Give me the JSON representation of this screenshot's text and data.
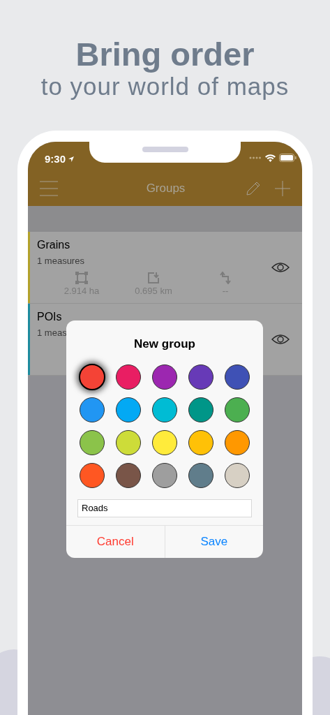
{
  "headline": {
    "title": "Bring order",
    "subtitle": "to your world of maps"
  },
  "status_bar": {
    "time": "9:30"
  },
  "nav_bar": {
    "title": "Groups"
  },
  "groups": [
    {
      "name": "Grains",
      "subtitle": "1 measures",
      "color": "#b3a22c",
      "stats": [
        {
          "kind": "area",
          "value": "2.914 ha"
        },
        {
          "kind": "length",
          "value": "0.695 km"
        },
        {
          "kind": "route",
          "value": "--"
        }
      ]
    },
    {
      "name": "POIs",
      "subtitle": "1 meas",
      "color": "#1e8c9e"
    }
  ],
  "dialog": {
    "title": "New group",
    "swatches": [
      {
        "color": "#f44336",
        "selected": true
      },
      {
        "color": "#e91e63",
        "selected": false
      },
      {
        "color": "#9c27b0",
        "selected": false
      },
      {
        "color": "#673ab7",
        "selected": false
      },
      {
        "color": "#3f51b5",
        "selected": false
      },
      {
        "color": "#2196f3",
        "selected": false
      },
      {
        "color": "#03a9f4",
        "selected": false
      },
      {
        "color": "#00bcd4",
        "selected": false
      },
      {
        "color": "#009688",
        "selected": false
      },
      {
        "color": "#4caf50",
        "selected": false
      },
      {
        "color": "#8bc34a",
        "selected": false
      },
      {
        "color": "#cddc39",
        "selected": false
      },
      {
        "color": "#ffeb3b",
        "selected": false
      },
      {
        "color": "#ffc107",
        "selected": false
      },
      {
        "color": "#ff9800",
        "selected": false
      },
      {
        "color": "#ff5722",
        "selected": false
      },
      {
        "color": "#795548",
        "selected": false
      },
      {
        "color": "#9e9e9e",
        "selected": false
      },
      {
        "color": "#607d8b",
        "selected": false
      },
      {
        "color": "#d7d0c4",
        "selected": false
      }
    ],
    "name_value": "Roads",
    "buttons": [
      {
        "kind": "cancel",
        "label": "Cancel"
      },
      {
        "kind": "save",
        "label": "Save"
      }
    ]
  }
}
